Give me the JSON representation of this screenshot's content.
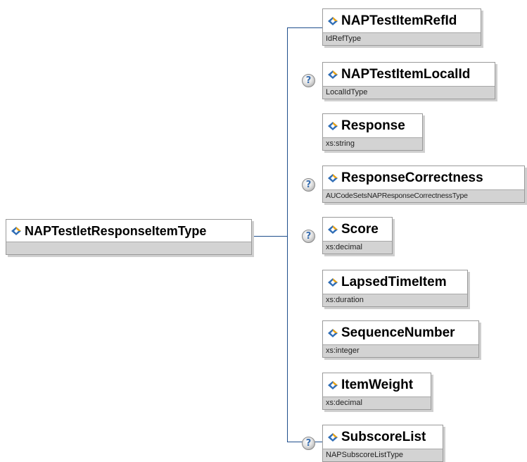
{
  "root": {
    "name": "NAPTestletResponseItemType",
    "type": ""
  },
  "children": [
    {
      "name": "NAPTestItemRefId",
      "type": "IdRefType",
      "optional": false
    },
    {
      "name": "NAPTestItemLocalId",
      "type": "LocalIdType",
      "optional": true
    },
    {
      "name": "Response",
      "type": "xs:string",
      "optional": false
    },
    {
      "name": "ResponseCorrectness",
      "type": "AUCodeSetsNAPResponseCorrectnessType",
      "optional": true
    },
    {
      "name": "Score",
      "type": "xs:decimal",
      "optional": true
    },
    {
      "name": "LapsedTimeItem",
      "type": "xs:duration",
      "optional": false
    },
    {
      "name": "SequenceNumber",
      "type": "xs:integer",
      "optional": false
    },
    {
      "name": "ItemWeight",
      "type": "xs:decimal",
      "optional": false
    },
    {
      "name": "SubscoreList",
      "type": "NAPSubscoreListType",
      "optional": true
    }
  ],
  "optional_marker": "?",
  "colors": {
    "connector": "#1f4e8c",
    "icon_main": "#2f6db5",
    "icon_accent": "#e8a317",
    "type_band": "#d3d3d3"
  }
}
